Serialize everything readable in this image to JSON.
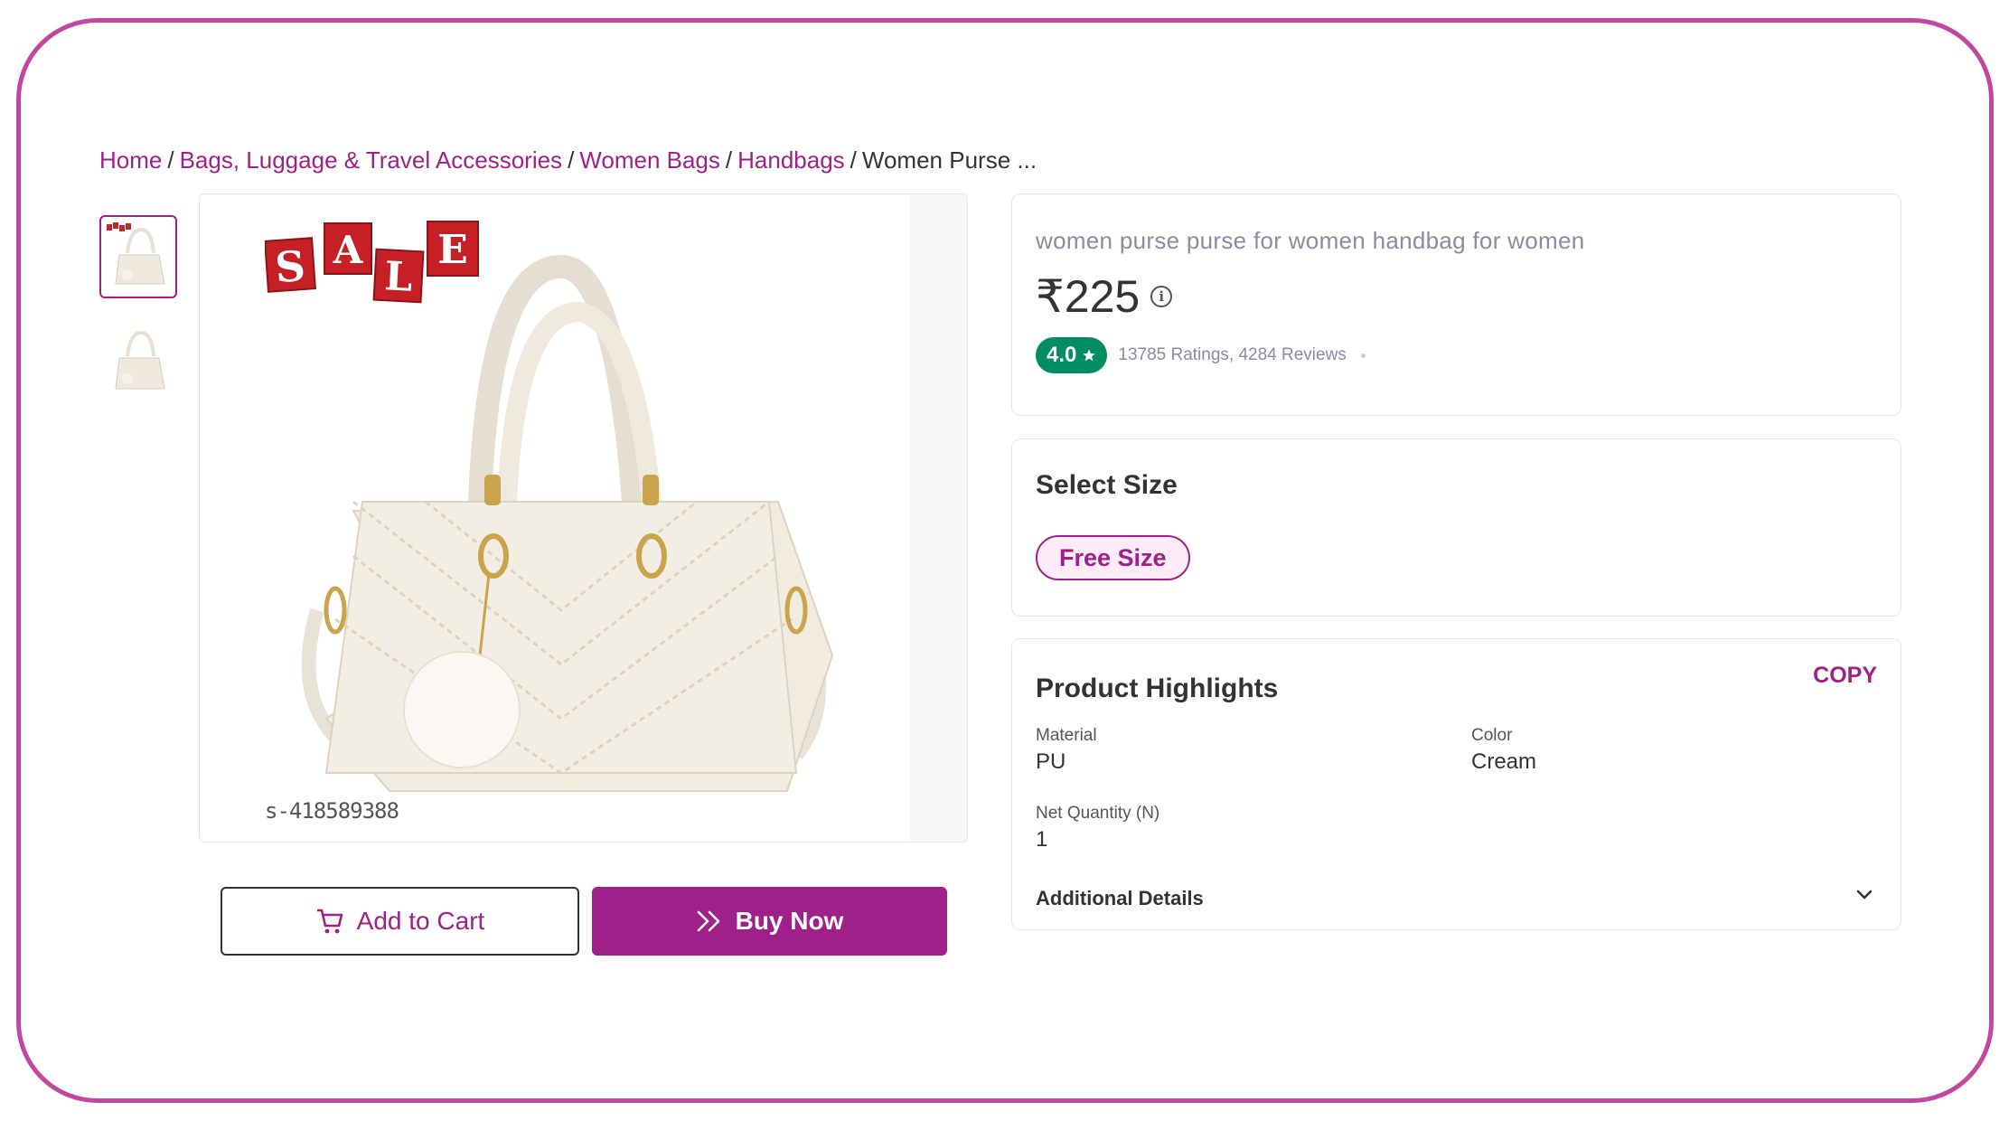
{
  "breadcrumb": {
    "items": [
      "Home",
      "Bags, Luggage & Travel Accessories",
      "Women Bags",
      "Handbags"
    ],
    "current": "Women Purse ...",
    "separator": "/"
  },
  "gallery": {
    "thumbnails": [
      "handbag-cream-sale",
      "handbag-cream"
    ],
    "main_image": {
      "badge_letters": [
        "S",
        "A",
        "L",
        "E"
      ],
      "sku_text": "s-418589388"
    }
  },
  "actions": {
    "add_to_cart": "Add to Cart",
    "buy_now": "Buy Now"
  },
  "product": {
    "title": "women purse purse for women handbag for women",
    "price": "₹225",
    "rating": "4.0",
    "ratings_reviews": "13785 Ratings, 4284 Reviews"
  },
  "size": {
    "heading": "Select Size",
    "options": [
      "Free Size"
    ]
  },
  "highlights": {
    "heading": "Product Highlights",
    "copy_label": "COPY",
    "attributes": [
      {
        "key": "Material",
        "value": "PU"
      },
      {
        "key": "Color",
        "value": "Cream"
      },
      {
        "key": "Net Quantity (N)",
        "value": "1"
      }
    ],
    "additional_label": "Additional Details"
  },
  "colors": {
    "accent": "#9f2089",
    "frame": "#c2479f",
    "rating_green": "#038d63",
    "chip_bg": "#fdebf7"
  },
  "icons": [
    "cart-icon",
    "double-chevron-right-icon",
    "info-icon",
    "star-icon",
    "chevron-down-icon"
  ]
}
